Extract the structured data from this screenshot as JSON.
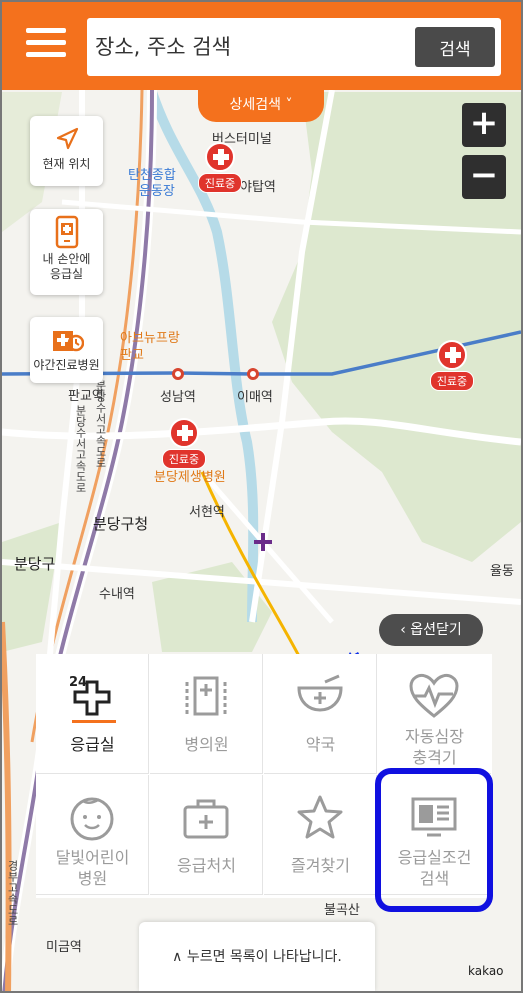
{
  "header": {
    "search_placeholder": "장소, 주소 검색",
    "search_button": "검색",
    "detail_search": "상세검색 ˅"
  },
  "side_buttons": [
    {
      "label": "현재 위치",
      "icon": "location-arrow-icon"
    },
    {
      "label_line1": "내 손안에",
      "label_line2": "응급실",
      "icon": "phone-emergency-icon"
    },
    {
      "label": "야간진료병원",
      "icon": "night-hospital-icon"
    }
  ],
  "zoom": {
    "in": "+",
    "out": "−"
  },
  "map_labels": {
    "bus_terminal": "버스터미널",
    "tancheon_line1": "탄천종합",
    "tancheon_line2": "운동장",
    "yatap": "야탑역",
    "avenue_france": "아브뉴프랑",
    "pangyo": "판교",
    "pangyo_station": "판교역",
    "seongnam_station": "성남역",
    "imae_station": "이매역",
    "bundang_jesaeng": "분당제생병원",
    "bundang_gucheong": "분당구청",
    "seohyeon": "서현역",
    "bundang_gu": "분당구",
    "sunae": "수내역",
    "yuldong": "율동",
    "bulgok": "불곡산",
    "mikeum": "미금역",
    "highway_left": "분당수서고속도로",
    "highway_mid": "분당수서고속도로",
    "highway_bottom": "경부고속도로",
    "kakao": "kakao"
  },
  "hospitals": [
    {
      "badge": "진료중"
    },
    {
      "badge": "진료중"
    },
    {
      "badge": "진료중"
    }
  ],
  "option_close": "옵션닫기",
  "menu_grid": [
    {
      "label": "응급실",
      "icon": "emergency-24-cross-icon",
      "active": true
    },
    {
      "label": "병의원",
      "icon": "hospital-building-icon"
    },
    {
      "label": "약국",
      "icon": "pharmacy-bowl-icon"
    },
    {
      "label_line1": "자동심장",
      "label_line2": "충격기",
      "icon": "defibrillator-heart-icon"
    },
    {
      "label_line1": "달빛어린이",
      "label_line2": "병원",
      "icon": "child-face-icon"
    },
    {
      "label": "응급처치",
      "icon": "first-aid-kit-icon"
    },
    {
      "label": "즐겨찾기",
      "icon": "star-icon"
    },
    {
      "label_line1": "응급실조건",
      "label_line2": "검색",
      "icon": "monitor-search-icon"
    }
  ],
  "bottom_bar": "∧ 누르면 목록이 나타납니다.",
  "colors": {
    "brand": "#f4711d",
    "highlight": "#1010e0",
    "arrow": "#0a2de8",
    "hospital": "#e0342c"
  }
}
